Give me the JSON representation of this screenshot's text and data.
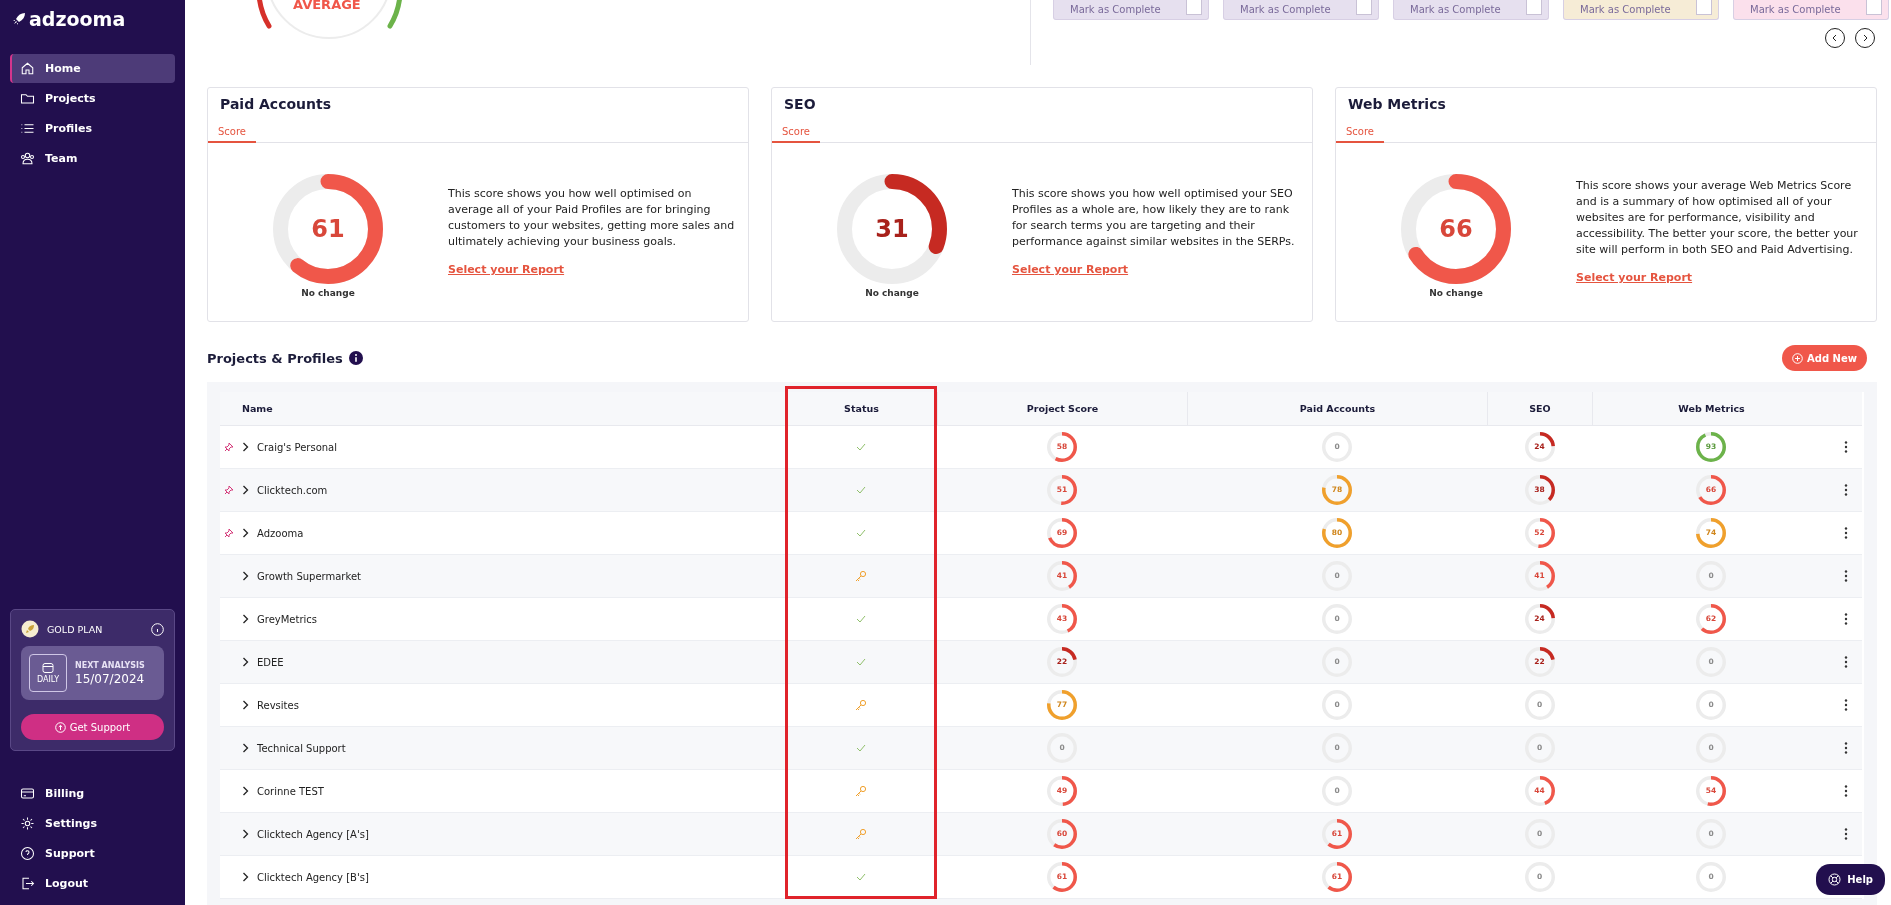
{
  "sidebar": {
    "logo": "adzooma",
    "nav": [
      {
        "label": "Home",
        "selected": true
      },
      {
        "label": "Projects",
        "selected": false
      },
      {
        "label": "Profiles",
        "selected": false
      },
      {
        "label": "Team",
        "selected": false
      }
    ],
    "plan": {
      "name": "GOLD PLAN",
      "frequency": "DAILY",
      "next_label": "NEXT ANALYSIS",
      "next_date": "15/07/2024",
      "button": "Get Support"
    },
    "bottom_nav": [
      {
        "label": "Billing",
        "selected": false
      },
      {
        "label": "Settings",
        "selected": false
      },
      {
        "label": "Support",
        "selected": false
      },
      {
        "label": "Logout",
        "selected": false
      }
    ]
  },
  "gauge": {
    "label": "AVERAGE"
  },
  "tasks": [
    {
      "label": "Mark as Complete",
      "checked": false,
      "color": "#e6e0ef"
    },
    {
      "label": "Mark as Complete",
      "checked": false,
      "color": "#e6e0ef"
    },
    {
      "label": "Mark as Complete",
      "checked": false,
      "color": "#e6e0ef"
    },
    {
      "label": "Mark as Complete",
      "checked": false,
      "color": "#f6ecd6"
    },
    {
      "label": "Mark as Complete",
      "checked": false,
      "color": "#fbe0ec"
    }
  ],
  "score_cards": [
    {
      "title": "Paid Accounts",
      "tab": "Score",
      "score": "61",
      "level": 0.61,
      "change": "No change",
      "description": "This score shows you how well optimised on average all of your Paid Profiles are for bringing customers to your websites, getting more sales and ultimately achieving your business goals.",
      "link": "Select your Report"
    },
    {
      "title": "SEO",
      "tab": "Score",
      "score": "31",
      "level": 0.31,
      "change": "No change",
      "description": "This score shows you how well optimised your SEO Profiles as a whole are, how likely they are to rank for search terms you are targeting and their performance against similar websites in the SERPs.",
      "link": "Select your Report"
    },
    {
      "title": "Web Metrics",
      "tab": "Score",
      "score": "66",
      "level": 0.66,
      "change": "No change",
      "description": "This score shows your average Web Metrics Score and is a summary of how optimised all of your websites are for performance, visibility and accessibility. The better your score, the better your site will perform in both SEO and Paid Advertising.",
      "link": "Select your Report"
    }
  ],
  "projects": {
    "title": "Projects & Profiles",
    "add_button": "Add New",
    "columns": [
      {
        "label": "Name",
        "highlighted": false
      },
      {
        "label": "Status",
        "highlighted": true
      },
      {
        "label": "Project Score",
        "highlighted": false
      },
      {
        "label": "Paid Accounts",
        "highlighted": false
      },
      {
        "label": "SEO",
        "highlighted": false
      },
      {
        "label": "Web Metrics",
        "highlighted": false
      }
    ],
    "rows": [
      {
        "name": "Craig's Personal",
        "pinned": true,
        "kind": "check",
        "scores": [
          {
            "value": "58",
            "level": 0.58
          },
          {
            "value": "0",
            "level": 0
          },
          {
            "value": "24",
            "level": 0.24
          },
          {
            "value": "93",
            "level": 0.93
          }
        ]
      },
      {
        "name": "Clicktech.com",
        "pinned": true,
        "kind": "check",
        "scores": [
          {
            "value": "51",
            "level": 0.51
          },
          {
            "value": "78",
            "level": 0.78
          },
          {
            "value": "38",
            "level": 0.38
          },
          {
            "value": "66",
            "level": 0.66
          }
        ]
      },
      {
        "name": "Adzooma",
        "pinned": true,
        "kind": "check",
        "scores": [
          {
            "value": "69",
            "level": 0.69
          },
          {
            "value": "80",
            "level": 0.8
          },
          {
            "value": "52",
            "level": 0.52
          },
          {
            "value": "74",
            "level": 0.74
          }
        ]
      },
      {
        "name": "Growth Supermarket",
        "pinned": false,
        "kind": "key",
        "scores": [
          {
            "value": "41",
            "level": 0.41
          },
          {
            "value": "0",
            "level": 0
          },
          {
            "value": "41",
            "level": 0.41
          },
          {
            "value": "0",
            "level": 0
          }
        ]
      },
      {
        "name": "GreyMetrics",
        "pinned": false,
        "kind": "check",
        "scores": [
          {
            "value": "43",
            "level": 0.43
          },
          {
            "value": "0",
            "level": 0
          },
          {
            "value": "24",
            "level": 0.24
          },
          {
            "value": "62",
            "level": 0.62
          }
        ]
      },
      {
        "name": "EDEE",
        "pinned": false,
        "kind": "check",
        "scores": [
          {
            "value": "22",
            "level": 0.22
          },
          {
            "value": "0",
            "level": 0
          },
          {
            "value": "22",
            "level": 0.22
          },
          {
            "value": "0",
            "level": 0
          }
        ]
      },
      {
        "name": "Revsites",
        "pinned": false,
        "kind": "key",
        "scores": [
          {
            "value": "77",
            "level": 0.77
          },
          {
            "value": "0",
            "level": 0
          },
          {
            "value": "0",
            "level": 0
          },
          {
            "value": "0",
            "level": 0
          }
        ]
      },
      {
        "name": "Technical Support",
        "pinned": false,
        "kind": "check",
        "scores": [
          {
            "value": "0",
            "level": 0
          },
          {
            "value": "0",
            "level": 0
          },
          {
            "value": "0",
            "level": 0
          },
          {
            "value": "0",
            "level": 0
          }
        ]
      },
      {
        "name": "Corinne TEST",
        "pinned": false,
        "kind": "key",
        "scores": [
          {
            "value": "49",
            "level": 0.49
          },
          {
            "value": "0",
            "level": 0
          },
          {
            "value": "44",
            "level": 0.44
          },
          {
            "value": "54",
            "level": 0.54
          }
        ]
      },
      {
        "name": "Clicktech Agency [A's]",
        "pinned": false,
        "kind": "key",
        "scores": [
          {
            "value": "60",
            "level": 0.6
          },
          {
            "value": "61",
            "level": 0.61
          },
          {
            "value": "0",
            "level": 0
          },
          {
            "value": "0",
            "level": 0
          }
        ]
      },
      {
        "name": "Clicktech Agency [B's]",
        "pinned": false,
        "kind": "check",
        "scores": [
          {
            "value": "61",
            "level": 0.61
          },
          {
            "value": "61",
            "level": 0.61
          },
          {
            "value": "0",
            "level": 0
          },
          {
            "value": "0",
            "level": 0
          }
        ]
      }
    ]
  },
  "help_button": "Help"
}
